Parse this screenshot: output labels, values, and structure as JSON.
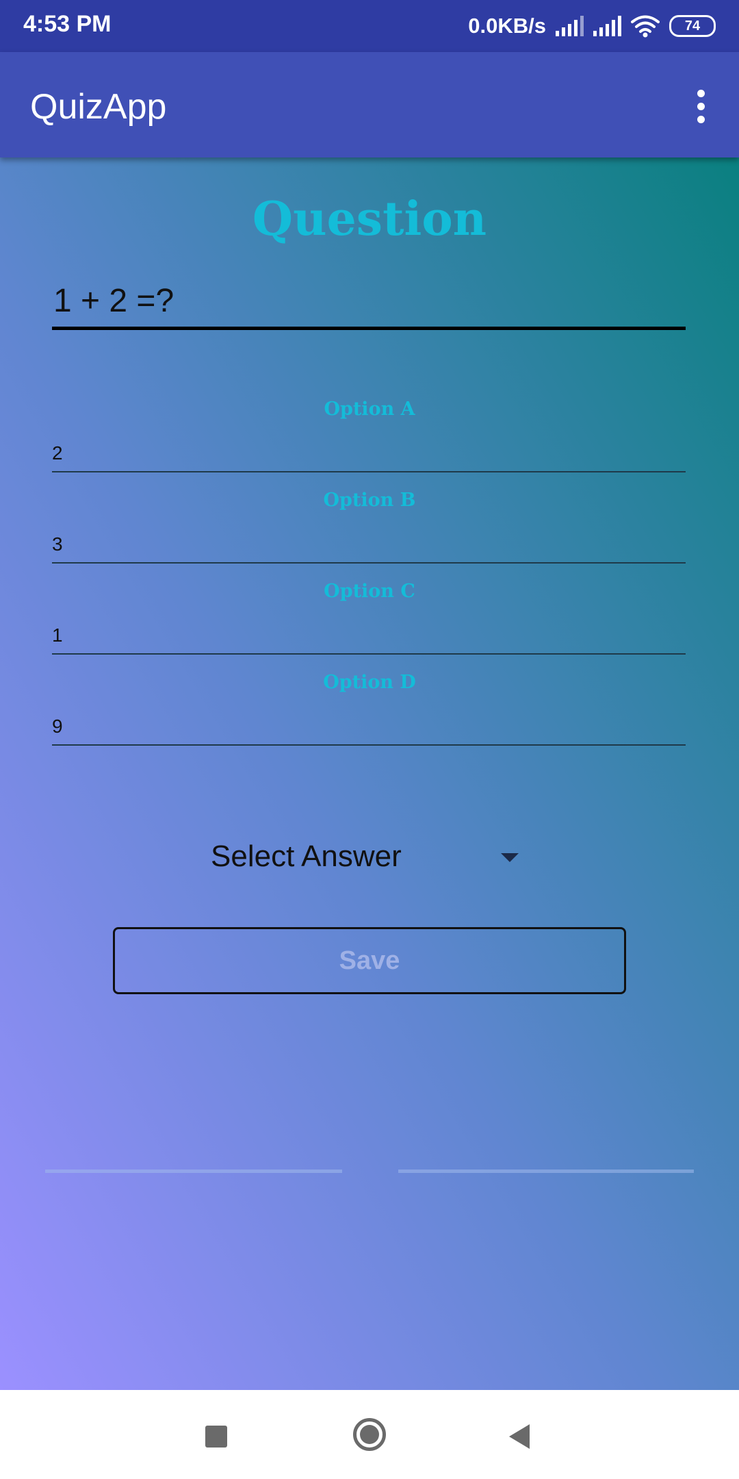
{
  "status_bar": {
    "time": "4:53 PM",
    "network_speed": "0.0KB/s",
    "battery_level": "74",
    "icons": [
      "signal-icon",
      "signal-icon",
      "wifi-icon",
      "battery-icon"
    ]
  },
  "app_bar": {
    "title": "QuizApp",
    "menu_icon": "more-vert-icon"
  },
  "form": {
    "heading": "Question",
    "question_value": "1 + 2 =?",
    "options": [
      {
        "label": "Option A",
        "value": "2"
      },
      {
        "label": "Option B",
        "value": "3"
      },
      {
        "label": "Option C",
        "value": "1"
      },
      {
        "label": "Option D",
        "value": "9"
      }
    ],
    "answer_select": {
      "selected": "Select Answer",
      "icon": "dropdown-arrow-icon"
    },
    "save_label": "Save"
  },
  "nav_bar": {
    "icons": [
      "recents-icon",
      "home-icon",
      "back-icon"
    ]
  },
  "colors": {
    "status_bar": "#2f3ca3",
    "app_bar": "#4050b6",
    "accent_label": "#14bcd8",
    "gradient_top_right": "#0a8080",
    "gradient_bottom_left": "#9b90ff"
  }
}
